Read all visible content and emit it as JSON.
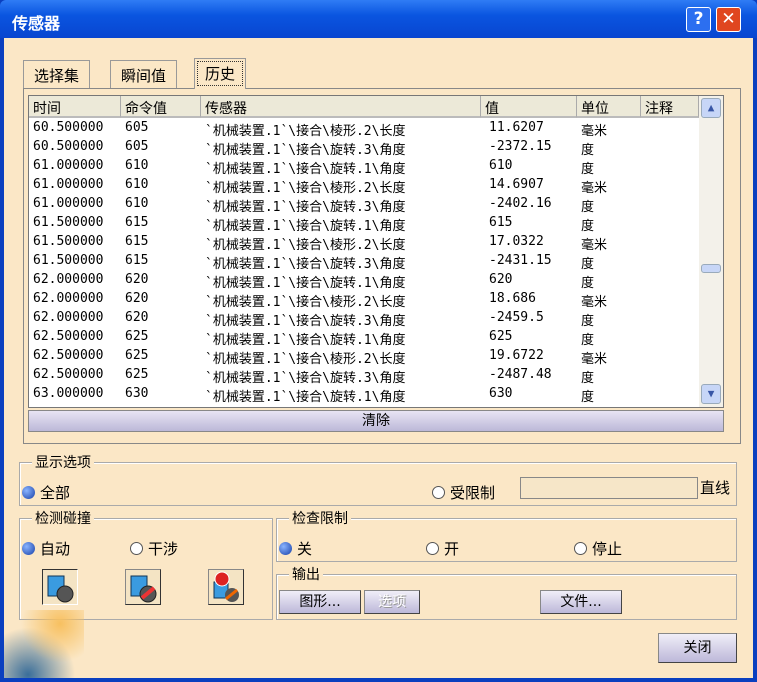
{
  "window": {
    "title": "传感器",
    "help": "?",
    "close": "✕"
  },
  "tabs": [
    "选择集",
    "瞬间值",
    "历史"
  ],
  "table": {
    "headers": [
      "时间",
      "命令值",
      "传感器",
      "值",
      "单位",
      "注释"
    ],
    "rows": [
      [
        "60.500000",
        "605",
        "`机械装置.1`\\接合\\棱形.2\\长度",
        "11.6207",
        "毫米"
      ],
      [
        "60.500000",
        "605",
        "`机械装置.1`\\接合\\旋转.3\\角度",
        "-2372.15",
        "度"
      ],
      [
        "61.000000",
        "610",
        "`机械装置.1`\\接合\\旋转.1\\角度",
        "610",
        "度"
      ],
      [
        "61.000000",
        "610",
        "`机械装置.1`\\接合\\棱形.2\\长度",
        "14.6907",
        "毫米"
      ],
      [
        "61.000000",
        "610",
        "`机械装置.1`\\接合\\旋转.3\\角度",
        "-2402.16",
        "度"
      ],
      [
        "61.500000",
        "615",
        "`机械装置.1`\\接合\\旋转.1\\角度",
        "615",
        "度"
      ],
      [
        "61.500000",
        "615",
        "`机械装置.1`\\接合\\棱形.2\\长度",
        "17.0322",
        "毫米"
      ],
      [
        "61.500000",
        "615",
        "`机械装置.1`\\接合\\旋转.3\\角度",
        "-2431.15",
        "度"
      ],
      [
        "62.000000",
        "620",
        "`机械装置.1`\\接合\\旋转.1\\角度",
        "620",
        "度"
      ],
      [
        "62.000000",
        "620",
        "`机械装置.1`\\接合\\棱形.2\\长度",
        "18.686",
        "毫米"
      ],
      [
        "62.000000",
        "620",
        "`机械装置.1`\\接合\\旋转.3\\角度",
        "-2459.5",
        "度"
      ],
      [
        "62.500000",
        "625",
        "`机械装置.1`\\接合\\旋转.1\\角度",
        "625",
        "度"
      ],
      [
        "62.500000",
        "625",
        "`机械装置.1`\\接合\\棱形.2\\长度",
        "19.6722",
        "毫米"
      ],
      [
        "62.500000",
        "625",
        "`机械装置.1`\\接合\\旋转.3\\角度",
        "-2487.48",
        "度"
      ],
      [
        "63.000000",
        "630",
        "`机械装置.1`\\接合\\旋转.1\\角度",
        "630",
        "度"
      ]
    ],
    "clear": "清除"
  },
  "display": {
    "label": "显示选项",
    "all": "全部",
    "limited": "受限制",
    "limited_value": "",
    "line": "直线"
  },
  "collision": {
    "label": "检测碰撞",
    "auto": "自动",
    "interference": "干涉"
  },
  "limits": {
    "label": "检查限制",
    "off": "关",
    "on": "开",
    "stop": "停止"
  },
  "output": {
    "label": "输出",
    "graph": "图形...",
    "options": "选项",
    "file": "文件..."
  },
  "close": "关闭"
}
